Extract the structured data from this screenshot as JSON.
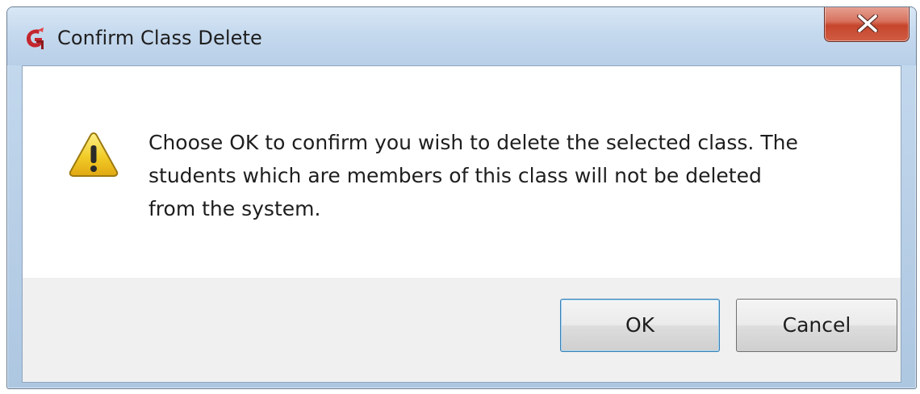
{
  "window": {
    "title": "Confirm Class Delete",
    "app_icon": "app-logo-icon",
    "close_icon": "close-icon"
  },
  "dialog": {
    "icon": "warning-icon",
    "message_lines": [
      "Choose OK to confirm you wish to delete the selected class.  The",
      "students which are members of this class will not be deleted",
      "from the system."
    ]
  },
  "buttons": {
    "ok_label": "OK",
    "cancel_label": "Cancel"
  },
  "colors": {
    "titlebar": "#c5d9ee",
    "close_button": "#c6452c",
    "warning_fill": "#f2cc28",
    "app_icon": "#c4262e",
    "button_area": "#f0f0f0"
  }
}
